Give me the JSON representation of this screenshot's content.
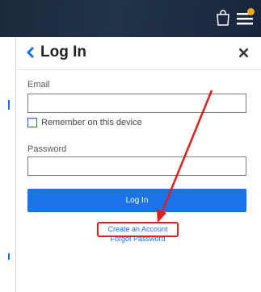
{
  "header": {
    "bag_icon": "shopping-bag-icon",
    "menu_icon": "hamburger-menu-icon",
    "notification_color": "#f5a623"
  },
  "login_panel": {
    "title": "Log In",
    "back_icon": "chevron-left-icon",
    "close_icon": "close-icon",
    "email_label": "Email",
    "email_value": "",
    "remember_label": "Remember on this device",
    "remember_checked": false,
    "password_label": "Password",
    "password_value": "",
    "login_button": "Log In",
    "create_account_link": "Create an Account",
    "forgot_password_link": "Forgot Password"
  },
  "colors": {
    "accent": "#1a73e8",
    "annotation": "#e11d1d",
    "header_bg": "#1a2a3c"
  }
}
